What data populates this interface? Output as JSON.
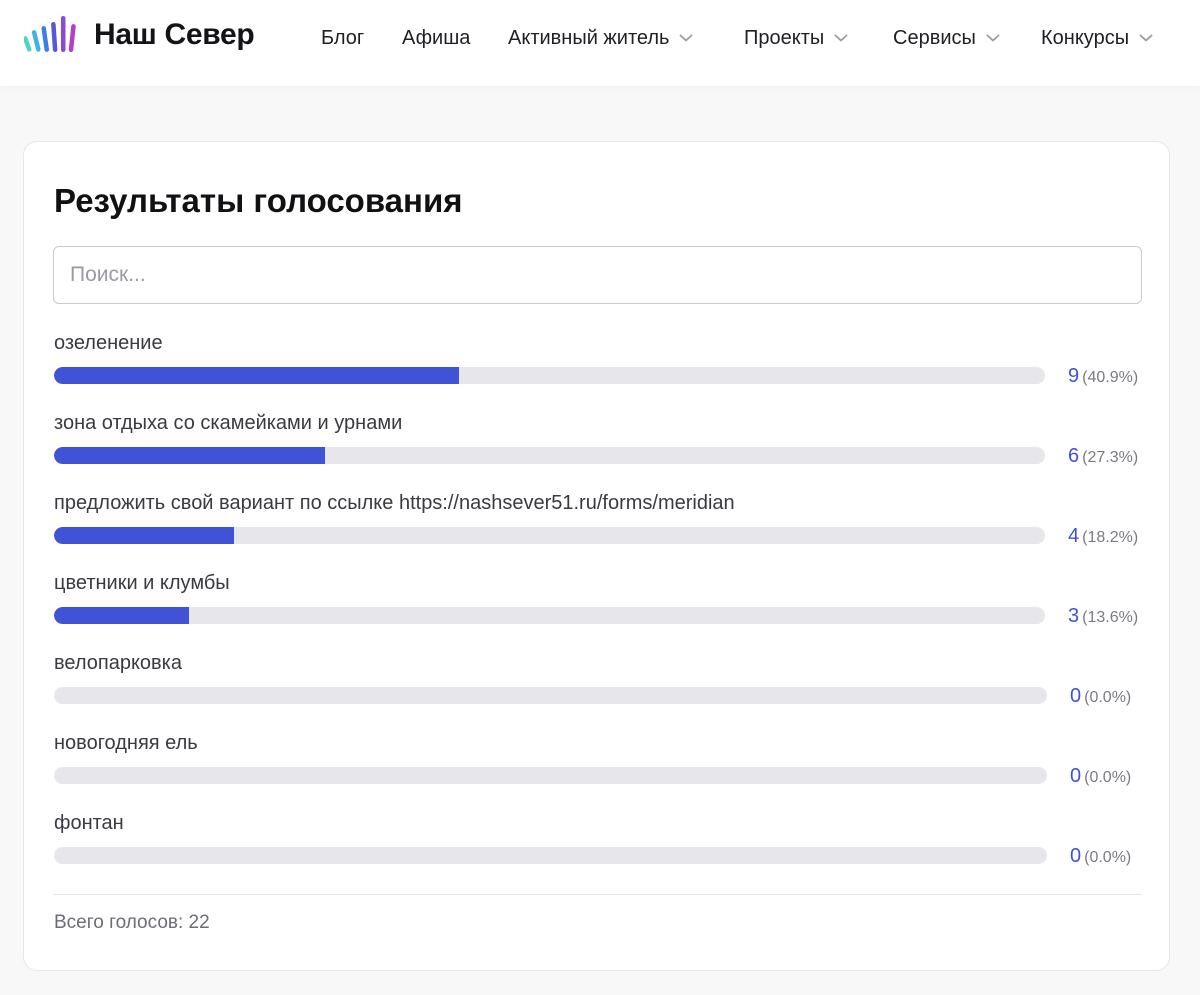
{
  "brand": {
    "name": "Наш Север",
    "logo_colors": [
      "#4fd3c4",
      "#3fb3e6",
      "#3d7fe0",
      "#5a55d8",
      "#8a4ad8",
      "#b040c8"
    ]
  },
  "nav": {
    "items": [
      {
        "label": "Блог",
        "has_dropdown": false
      },
      {
        "label": "Афиша",
        "has_dropdown": false
      },
      {
        "label": "Активный житель",
        "has_dropdown": true
      },
      {
        "label": "Проекты",
        "has_dropdown": true
      },
      {
        "label": "Сервисы",
        "has_dropdown": true
      },
      {
        "label": "Конкурсы",
        "has_dropdown": true
      }
    ]
  },
  "poll": {
    "title": "Результаты голосования",
    "search_placeholder": "Поиск...",
    "total_label": "Всего голосов: 22",
    "options": [
      {
        "label": "озеленение",
        "count": "9",
        "percent_text": "(40.9%)",
        "fraction": 0.409
      },
      {
        "label": "зона отдыха со скамейками и урнами",
        "count": "6",
        "percent_text": "(27.3%)",
        "fraction": 0.273
      },
      {
        "label": "предложить свой вариант по ссылке https://nashsever51.ru/forms/meridian",
        "count": "4",
        "percent_text": "(18.2%)",
        "fraction": 0.182
      },
      {
        "label": "цветники и клумбы",
        "count": "3",
        "percent_text": "(13.6%)",
        "fraction": 0.136
      },
      {
        "label": "велопарковка",
        "count": "0",
        "percent_text": "(0.0%)",
        "fraction": 0.0
      },
      {
        "label": "новогодняя ель",
        "count": "0",
        "percent_text": "(0.0%)",
        "fraction": 0.0
      },
      {
        "label": "фонтан",
        "count": "0",
        "percent_text": "(0.0%)",
        "fraction": 0.0
      }
    ]
  },
  "colors": {
    "accent": "#4052d6",
    "track": "#e7e7eb"
  }
}
